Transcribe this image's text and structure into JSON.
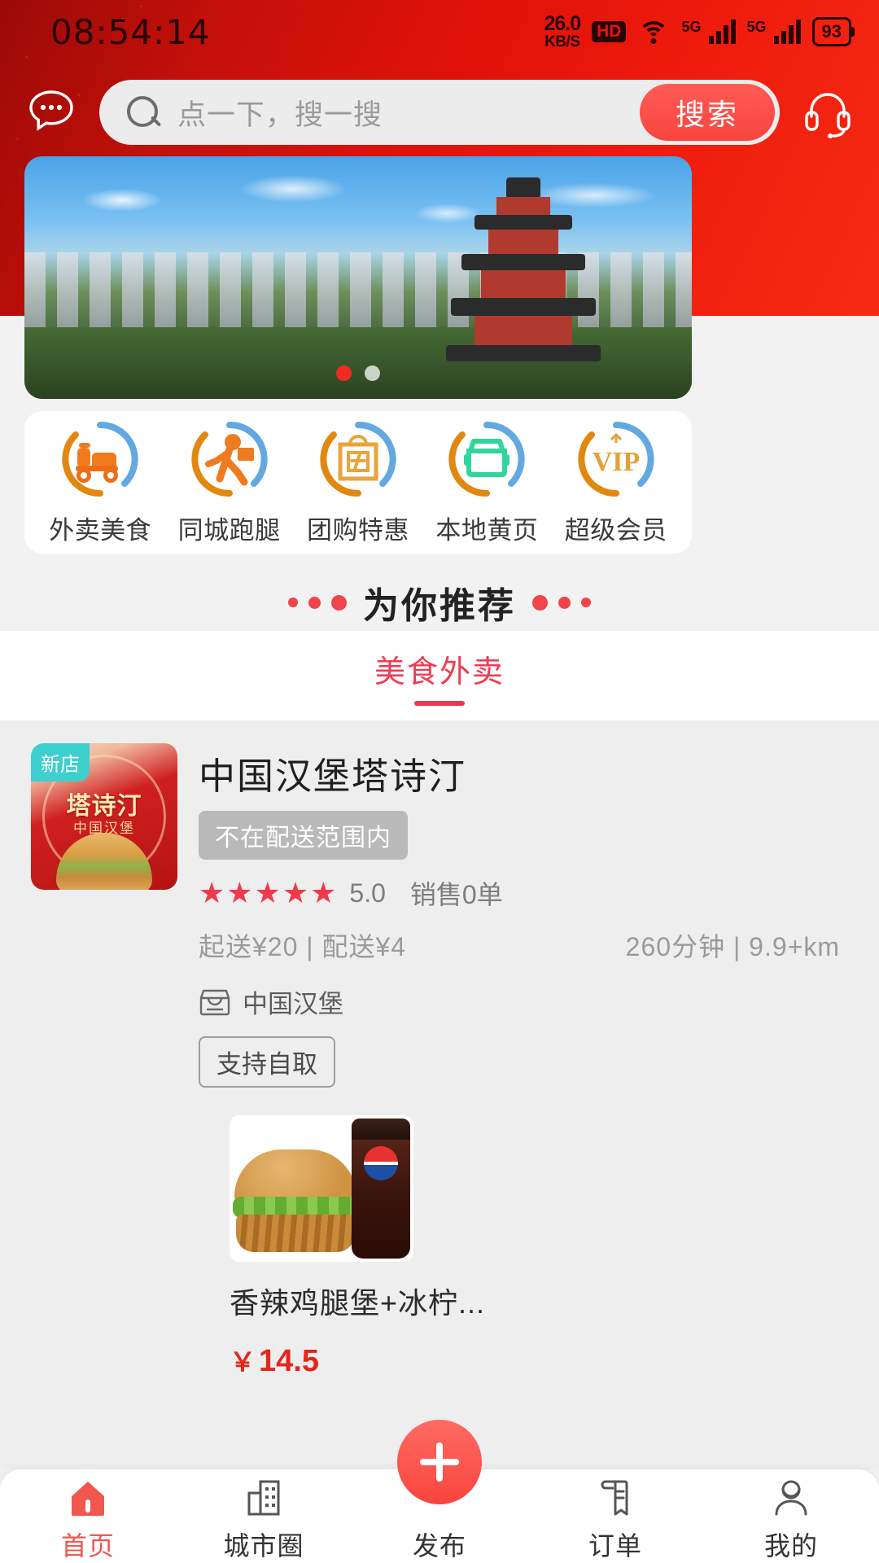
{
  "status_bar": {
    "time": "08:54:14",
    "net_speed_value": "26.0",
    "net_speed_unit": "KB/S",
    "hd_badge": "HD",
    "signal_5g_label_1": "5G",
    "signal_5g_label_2": "5G",
    "battery_percent": "93"
  },
  "header": {
    "chat_icon": "chat-bubble-icon",
    "search_placeholder": "点一下，搜一搜",
    "search_button": "搜索",
    "service_icon": "headset-icon"
  },
  "banner": {
    "slides_count": 2,
    "active_slide": 0,
    "alt": "城市全景与古塔"
  },
  "categories": [
    {
      "label": "外卖美食",
      "icon": "scooter-delivery-icon"
    },
    {
      "label": "同城跑腿",
      "icon": "running-courier-icon"
    },
    {
      "label": "团购特惠",
      "icon": "group-buy-bag-icon"
    },
    {
      "label": "本地黄页",
      "icon": "car-front-icon"
    },
    {
      "label": "超级会员",
      "icon": "vip-crown-icon"
    }
  ],
  "recommend": {
    "title": "为你推荐"
  },
  "tabs": [
    {
      "label": "美食外卖",
      "active": true
    }
  ],
  "shop": {
    "badge": "新店",
    "thumb_title": "塔诗汀",
    "thumb_sub": "中国汉堡",
    "name": "中国汉堡塔诗汀",
    "delivery_status": "不在配送范围内",
    "rating": "5.0",
    "stars": 5,
    "sales": "销售0单",
    "min_order": "起送¥20 | 配送¥4",
    "eta": "260分钟 | 9.9+km",
    "category_icon": "storefront-icon",
    "category": "中国汉堡",
    "pickup_tag": "支持自取",
    "dish": {
      "name": "香辣鸡腿堡+冰柠...",
      "price_symbol": "￥",
      "price": "14.5"
    }
  },
  "bottom_nav": {
    "fab": {
      "label": "发布",
      "icon": "plus-icon"
    },
    "items": [
      {
        "label": "首页",
        "icon": "home-icon",
        "active": true
      },
      {
        "label": "城市圈",
        "icon": "city-building-icon",
        "active": false
      },
      {
        "label": "发布",
        "icon": "publish-icon",
        "active": false,
        "is_fab": true
      },
      {
        "label": "订单",
        "icon": "receipt-icon",
        "active": false
      },
      {
        "label": "我的",
        "icon": "user-icon",
        "active": false
      }
    ]
  },
  "colors": {
    "brand_red": "#e01208",
    "accent_red": "#f0434a",
    "price_red": "#e5251c",
    "badge_teal": "#3ecfcf",
    "muted_gray": "#9a9a9a"
  }
}
